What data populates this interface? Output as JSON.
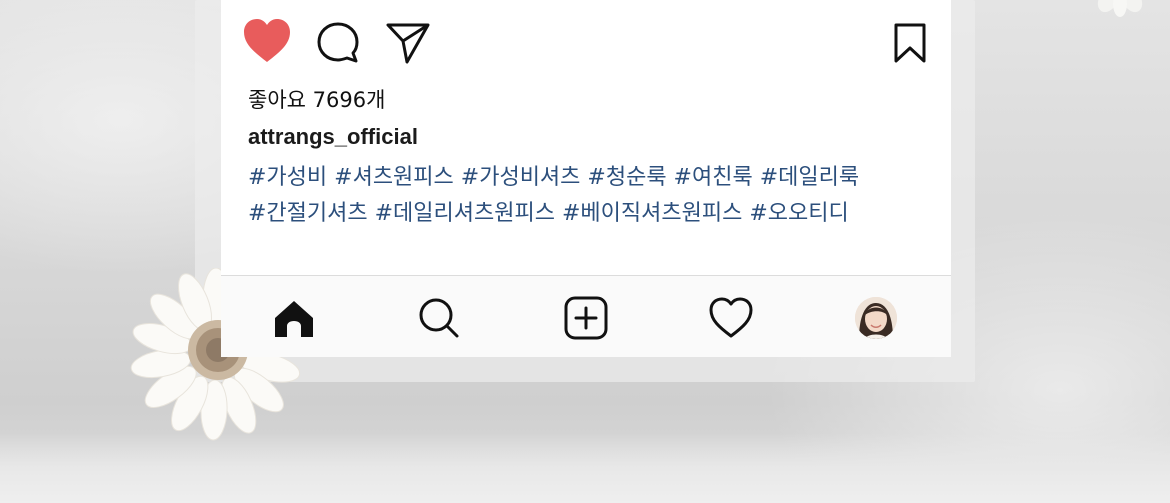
{
  "post": {
    "likes_text": "좋아요 7696개",
    "username": "attrangs_official",
    "hashtag_lines": [
      "#가성비 #셔츠원피스 #가성비셔츠 #청순룩 #여친룩 #데일리룩",
      "#간절기셔츠 #데일리셔츠원피스 #베이직셔츠원피스 #오오티디"
    ]
  },
  "colors": {
    "like_active": "#e85c5c",
    "hashtag": "#2c4f7c",
    "icon": "#111111"
  },
  "icons": {
    "like": "heart-filled-icon",
    "comment": "comment-bubble-icon",
    "share": "paper-plane-icon",
    "save": "bookmark-icon",
    "tab_home": "home-icon",
    "tab_search": "search-icon",
    "tab_new_post": "add-post-icon",
    "tab_activity": "heart-outline-icon",
    "tab_profile": "profile-avatar"
  }
}
